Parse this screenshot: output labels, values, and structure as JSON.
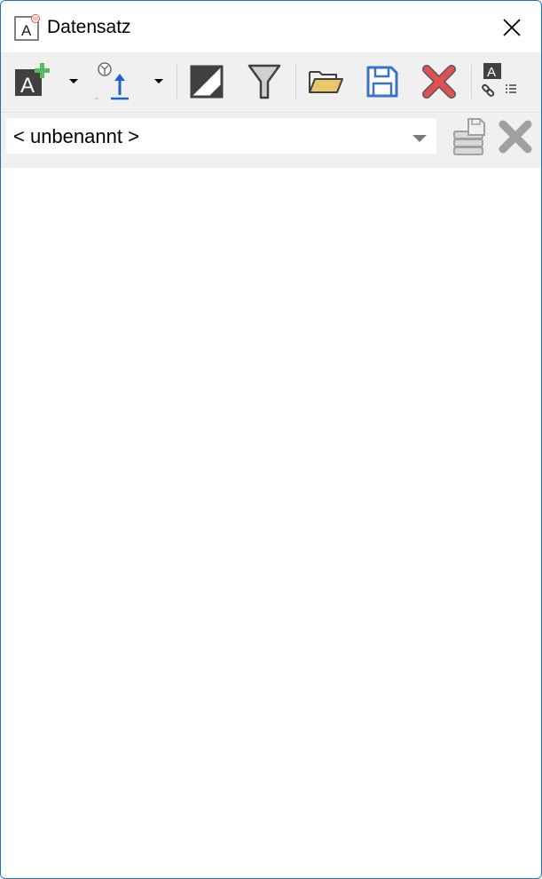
{
  "window": {
    "title": "Datensatz"
  },
  "toolbar": {
    "buttons": [
      {
        "icon": "add-attribute-icon",
        "has_dropdown": true
      },
      {
        "icon": "import-upload-icon",
        "has_dropdown": true
      },
      {
        "icon": "contrast-icon",
        "has_dropdown": false
      },
      {
        "icon": "filter-icon",
        "has_dropdown": false
      },
      {
        "icon": "open-folder-icon",
        "has_dropdown": false
      },
      {
        "icon": "save-icon",
        "has_dropdown": false
      },
      {
        "icon": "delete-icon",
        "has_dropdown": false
      },
      {
        "icon": "link-attributes-icon",
        "has_dropdown": false
      }
    ]
  },
  "dataset": {
    "selected": "< unbenannt >"
  },
  "colors": {
    "window_border": "#1f6fc4",
    "toolbar_bg": "#f0f0f0",
    "add_green": "#5cb85c",
    "upload_blue": "#1e64c8",
    "delete_red": "#e05252",
    "save_blue": "#3b73c4",
    "folder_yellow": "#e8c76a",
    "disabled_gray": "#a0a0a0"
  }
}
